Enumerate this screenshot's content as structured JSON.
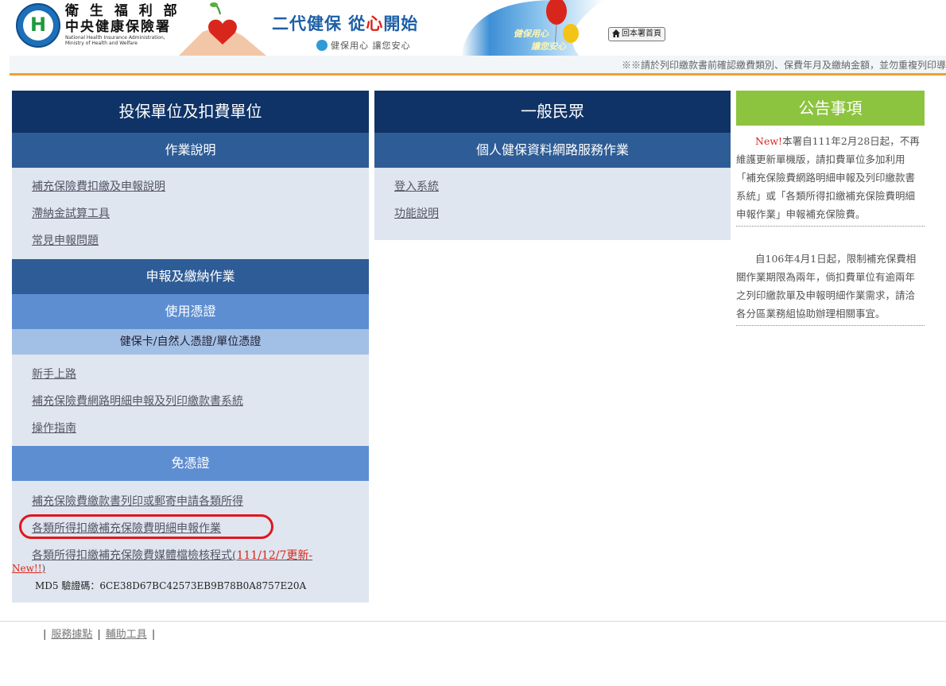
{
  "header": {
    "agency_line1": "衛 生 福 利 部",
    "agency_line2": "中央健康保險署",
    "agency_en1": "National Health Insurance Administration,",
    "agency_en2": "Ministry  of  Health  and  Welfare",
    "slogan_part1": "二代健保 從",
    "slogan_red": "心",
    "slogan_part2": "開始",
    "sub_slogan": "健保用心 讓您安心",
    "banner_text1": "健保用心",
    "banner_text2": "讓您安心",
    "home_button": "回本署首頁",
    "notice_marquee": "※※請於列印繳款書前確認繳費類別、保費年月及繳納金額，並勿重複列印導"
  },
  "col1": {
    "title": "投保單位及扣費單位",
    "section1": "作業說明",
    "section1_links": [
      "補充保險費扣繳及申報說明",
      "滯納金試算工具",
      "常見申報問題"
    ],
    "section2": "申報及繳納作業",
    "section2a": "使用憑證",
    "section2a_sub": "健保卡/自然人憑證/單位憑證",
    "section2a_links": [
      "新手上路",
      "補充保險費網路明細申報及列印繳款書系統",
      "操作指南"
    ],
    "section2b": "免憑證",
    "section2b_links": [
      "補充保險費繳款書列印或郵寄申請各類所得",
      "各類所得扣繳補充保險費明細申報作業"
    ],
    "tax_link_main": "各類所得扣繳補充保險費媒體檔檢核程式(",
    "tax_link_new_part1": "111/12/7更新-",
    "tax_link_new_part2": "New!!",
    "tax_link_close": ")",
    "md5": "MD5 驗證碼：6CE38D67BC42573EB9B78B0A8757E20A"
  },
  "col2": {
    "title": "一般民眾",
    "section1": "個人健保資料網路服務作業",
    "links": [
      "登入系統",
      "功能說明"
    ]
  },
  "col3": {
    "title": "公告事項",
    "notice1_new": "New!",
    "notice1": "本署自111年2月28日起，不再維護更新單機版，請扣費單位多加利用「補充保險費網路明細申報及列印繳款書系統」或「各類所得扣繳補充保險費明細申報作業」申報補充保險費。",
    "notice2": "自106年4月1日起，限制補充保費相關作業期限為兩年，倘扣費單位有逾兩年之列印繳款單及申報明細作業需求，請洽各分區業務組協助辦理相關事宜。"
  },
  "footer": {
    "links": [
      "服務據點",
      "輔助工具"
    ]
  },
  "colors": {
    "navy": "#0f3366",
    "section_blue": "#2e5c96",
    "light_blue": "#5e8ed2",
    "panel_bg": "#dfe6ef",
    "announce_green": "#8cc43f",
    "highlight_red": "#e0161f"
  }
}
